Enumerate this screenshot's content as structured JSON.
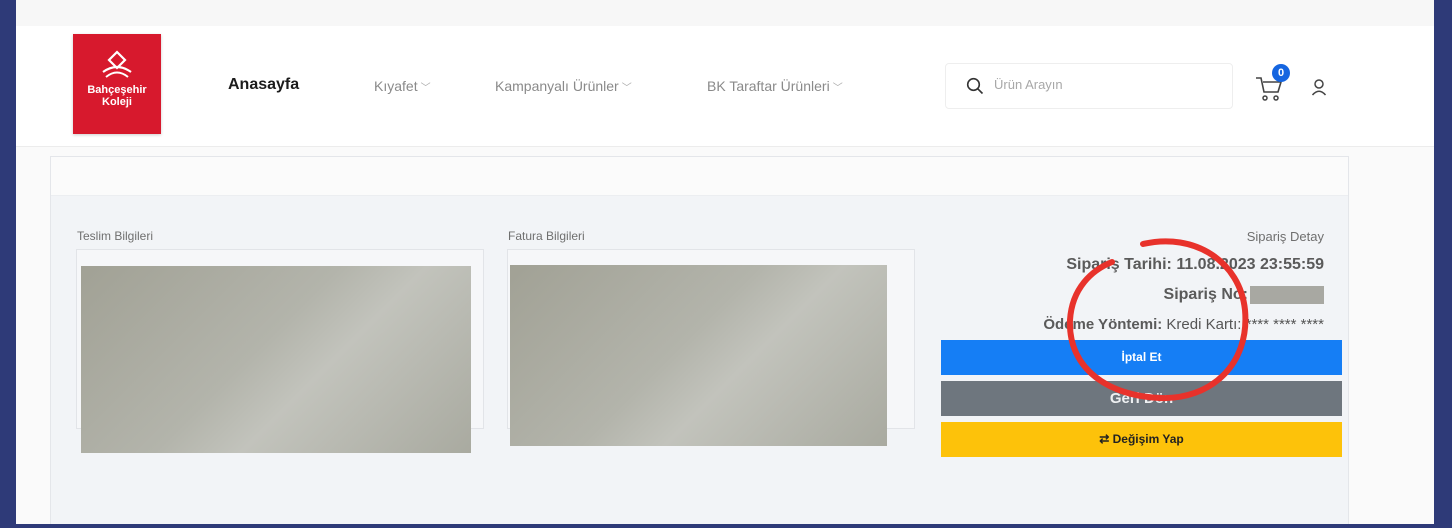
{
  "header": {
    "logo": {
      "line1": "Bahçeşehir",
      "line2": "Koleji"
    },
    "nav": [
      {
        "label": "Anasayfa"
      },
      {
        "label": "Kıyafet"
      },
      {
        "label": "Kampanyalı Ürünler"
      },
      {
        "label": "BK Taraftar Ürünleri"
      }
    ],
    "search": {
      "placeholder": "Ürün Arayın",
      "value": ""
    },
    "cart_count": "0"
  },
  "order": {
    "delivery_label": "Teslim Bilgileri",
    "invoice_label": "Fatura Bilgileri",
    "detail_title": "Sipariş Detay",
    "date_label": "Sipariş Tarihi:",
    "date_value": "11.08.2023 23:55:59",
    "number_label": "Sipariş No:",
    "payment_label": "Ödeme Yöntemi:",
    "payment_value": "Kredi Kartı: **** **** ****",
    "buttons": {
      "cancel": "İptal Et",
      "back": "Geri Dön",
      "exchange": "⇄ Değişim Yap"
    }
  },
  "colors": {
    "brand_red": "#d7192d",
    "cancel_blue": "#157ef5",
    "back_gray": "#6e767e",
    "exchange_yellow": "#fdc20a",
    "annotation_red": "#e8322b",
    "frame_blue": "#2e3a78"
  },
  "icons": [
    "search-icon",
    "cart-icon",
    "user-icon",
    "chevron-down-icon",
    "exchange-icon"
  ]
}
